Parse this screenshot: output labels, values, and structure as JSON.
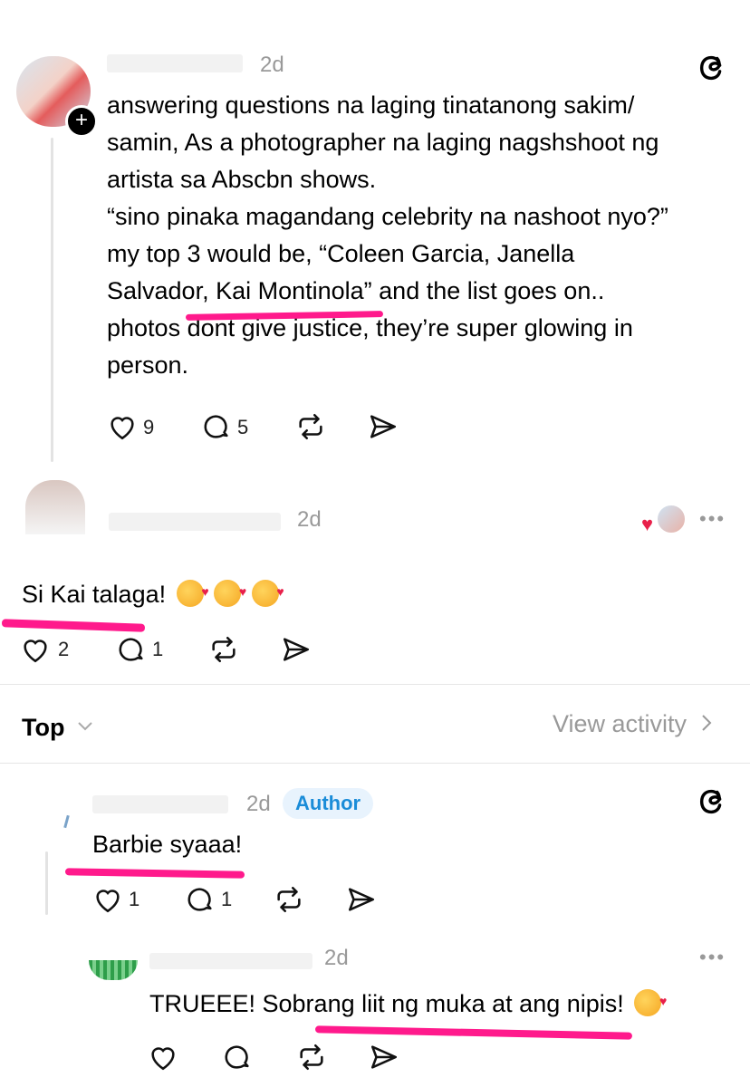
{
  "post": {
    "time": "2d",
    "lines": [
      "answering questions na laging tinatanong sakim/",
      "samin, As a photographer na laging nagshshoot ng",
      "artista sa Abscbn shows.",
      "“sino pinaka magandang celebrity na nashoot nyo?”",
      "my top 3 would be, “Coleen Garcia, Janella",
      "Salvador, Kai Montinola” and the list goes on..",
      "photos dont give justice, they’re super glowing in",
      "person."
    ],
    "likes": "9",
    "replies": "5"
  },
  "reply1": {
    "time": "2d",
    "text": "Si Kai talaga!",
    "likes": "2",
    "replies": "1"
  },
  "sort": {
    "label": "Top",
    "view_activity": "View activity"
  },
  "comment1": {
    "time": "2d",
    "badge": "Author",
    "text": "Barbie syaaa!",
    "likes": "1",
    "replies": "1"
  },
  "comment2": {
    "time": "2d",
    "text": "TRUEEE! Sobrang liit ng muka at ang nipis!"
  },
  "colors": {
    "highlight": "#ff1a8c",
    "author_badge_bg": "#e8f3fd",
    "author_badge_text": "#1a8cd8"
  }
}
